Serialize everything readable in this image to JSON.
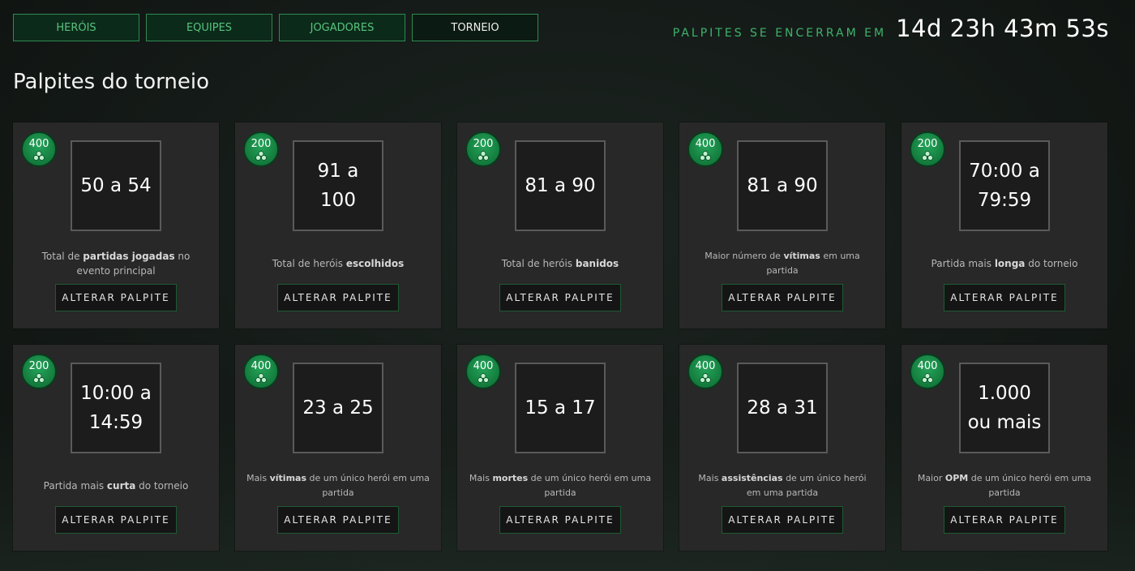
{
  "nav": {
    "tabs": [
      {
        "label": "HERÓIS",
        "active": false
      },
      {
        "label": "EQUIPES",
        "active": false
      },
      {
        "label": "JOGADORES",
        "active": false
      },
      {
        "label": "TORNEIO",
        "active": true
      }
    ]
  },
  "countdown": {
    "label": "PALPITES SE ENCERRAM EM",
    "value": "14d 23h 43m 53s"
  },
  "page_title": "Palpites do torneio",
  "cards": [
    {
      "points": "400",
      "prediction": "50 a 54",
      "desc_parts": [
        {
          "t": "Total de ",
          "b": false
        },
        {
          "t": "partidas jogadas",
          "b": true
        },
        {
          "t": " no evento principal",
          "b": false
        }
      ],
      "button": "ALTERAR PALPITE"
    },
    {
      "points": "200",
      "prediction": "91 a 100",
      "desc_parts": [
        {
          "t": "Total de heróis ",
          "b": false
        },
        {
          "t": "escolhidos",
          "b": true
        }
      ],
      "button": "ALTERAR PALPITE"
    },
    {
      "points": "200",
      "prediction": "81 a 90",
      "desc_parts": [
        {
          "t": "Total de heróis ",
          "b": false
        },
        {
          "t": "banidos",
          "b": true
        }
      ],
      "button": "ALTERAR PALPITE"
    },
    {
      "points": "400",
      "prediction": "81 a 90",
      "desc_parts": [
        {
          "t": "Maior número de ",
          "b": false
        },
        {
          "t": "vítimas",
          "b": true
        },
        {
          "t": " em uma partida",
          "b": false
        }
      ],
      "button": "ALTERAR PALPITE"
    },
    {
      "points": "200",
      "prediction": "70:00 a 79:59",
      "desc_parts": [
        {
          "t": "Partida mais ",
          "b": false
        },
        {
          "t": "longa",
          "b": true
        },
        {
          "t": " do torneio",
          "b": false
        }
      ],
      "button": "ALTERAR PALPITE"
    },
    {
      "points": "200",
      "prediction": "10:00 a 14:59",
      "desc_parts": [
        {
          "t": "Partida mais ",
          "b": false
        },
        {
          "t": "curta",
          "b": true
        },
        {
          "t": " do torneio",
          "b": false
        }
      ],
      "button": "ALTERAR PALPITE"
    },
    {
      "points": "400",
      "prediction": "23 a 25",
      "desc_parts": [
        {
          "t": "Mais ",
          "b": false
        },
        {
          "t": "vítimas",
          "b": true
        },
        {
          "t": " de um único herói em uma partida",
          "b": false
        }
      ],
      "button": "ALTERAR PALPITE"
    },
    {
      "points": "400",
      "prediction": "15 a 17",
      "desc_parts": [
        {
          "t": "Mais ",
          "b": false
        },
        {
          "t": "mortes",
          "b": true
        },
        {
          "t": " de um único herói em uma partida",
          "b": false
        }
      ],
      "button": "ALTERAR PALPITE"
    },
    {
      "points": "400",
      "prediction": "28 a 31",
      "desc_parts": [
        {
          "t": "Mais ",
          "b": false
        },
        {
          "t": "assistências",
          "b": true
        },
        {
          "t": " de um único herói em uma partida",
          "b": false
        }
      ],
      "button": "ALTERAR PALPITE"
    },
    {
      "points": "400",
      "prediction": "1.000 ou mais",
      "desc_parts": [
        {
          "t": "Maior ",
          "b": false
        },
        {
          "t": "OPM",
          "b": true
        },
        {
          "t": " de um único herói em uma partida",
          "b": false
        }
      ],
      "button": "ALTERAR PALPITE"
    }
  ],
  "icons": {
    "points_badge": "points-coin-icon"
  },
  "colors": {
    "accent_green": "#3fb36b",
    "badge_green": "#137a3c",
    "card_bg": "#282828"
  }
}
